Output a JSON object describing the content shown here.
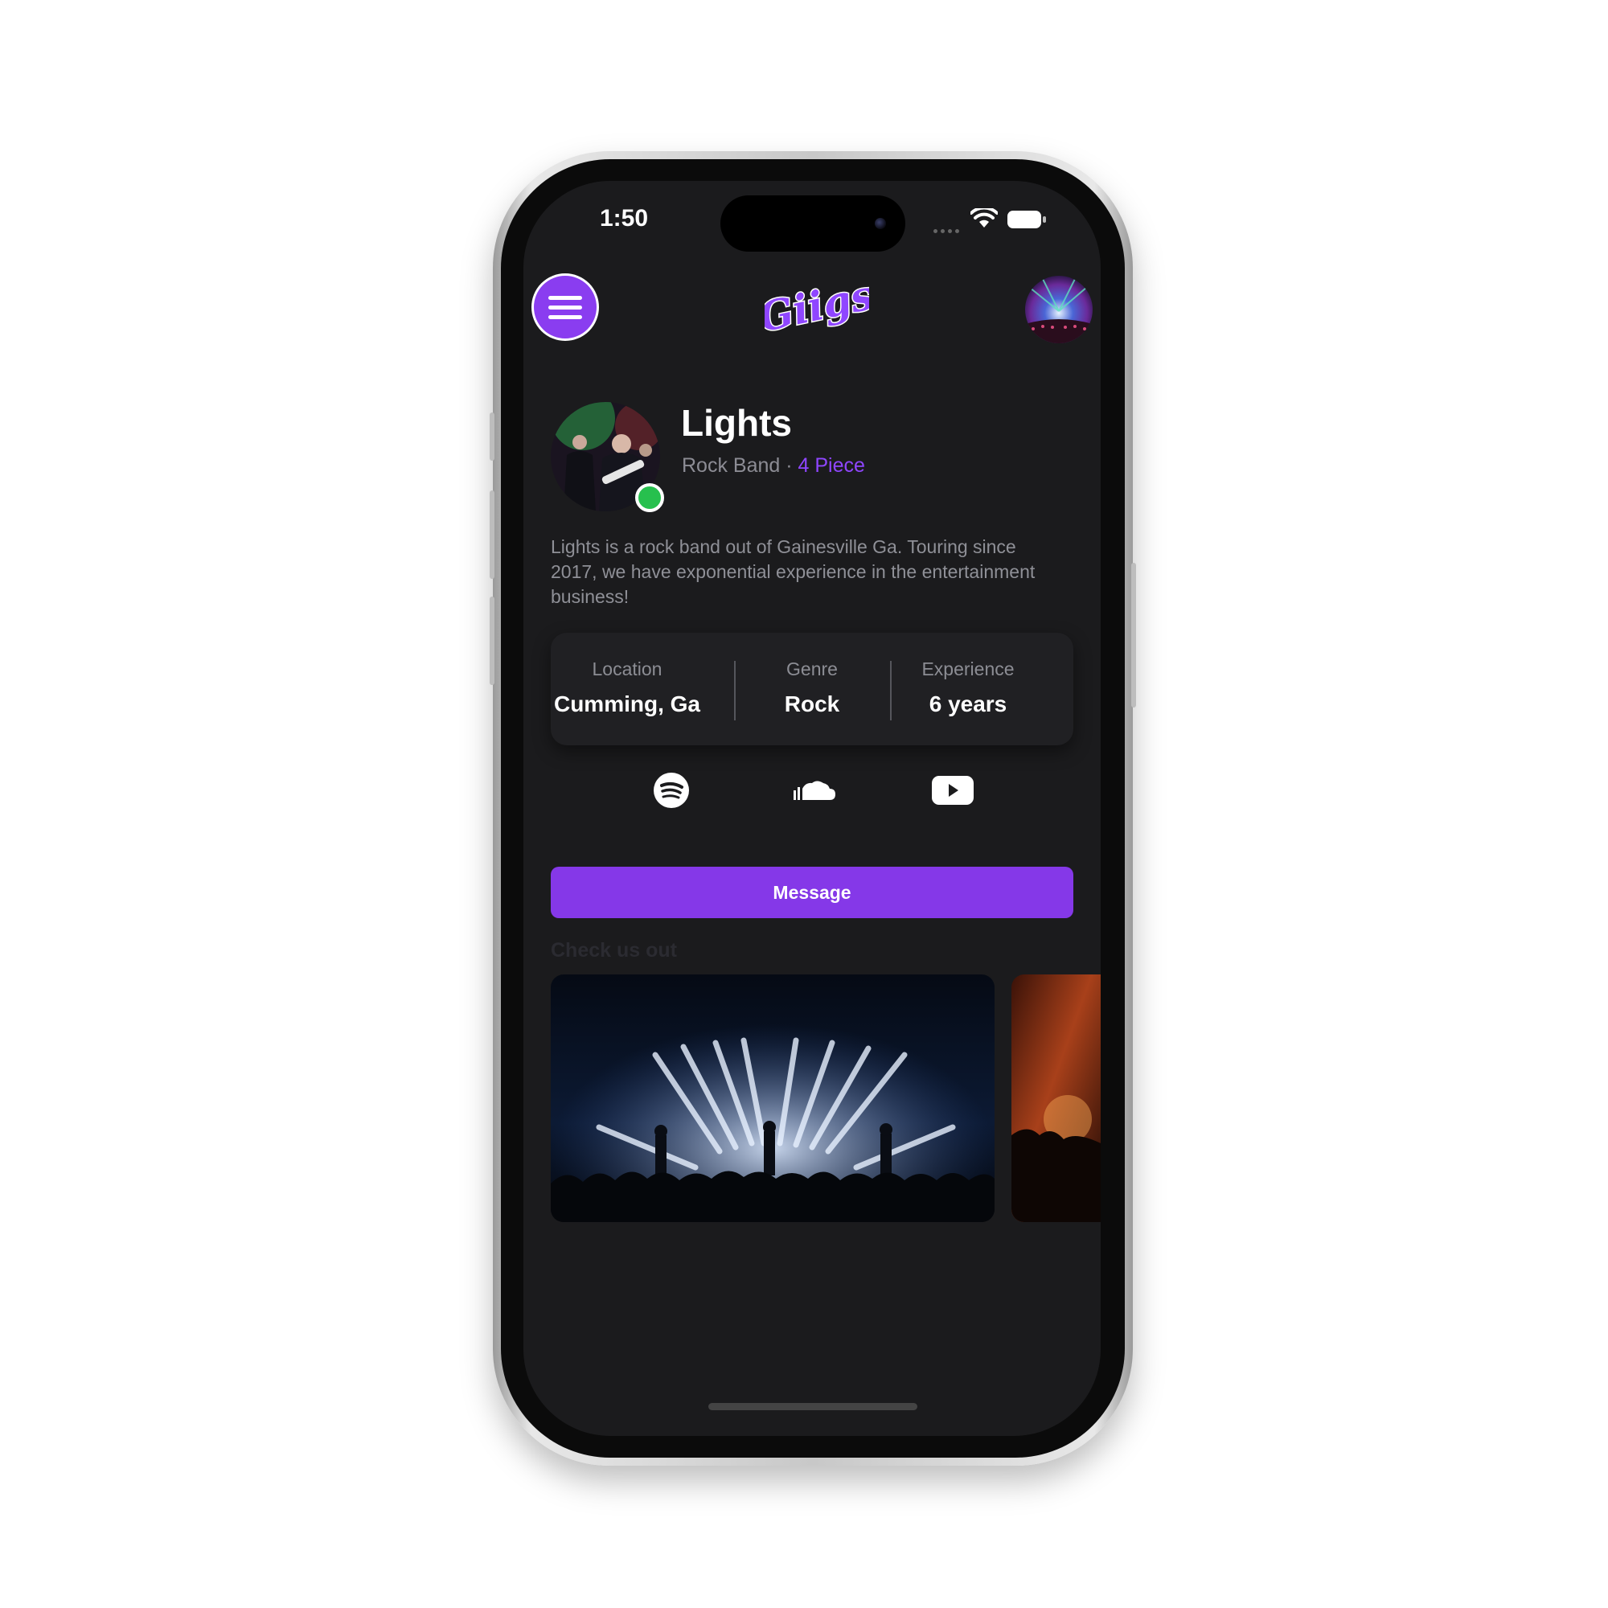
{
  "status_bar": {
    "time": "1:50"
  },
  "header": {
    "app_name": "Giigs"
  },
  "profile": {
    "name": "Lights",
    "category": "Rock Band",
    "separator": "·",
    "size": "4 Piece",
    "online": true,
    "bio": "Lights is a rock band out of Gainesville Ga. Touring since 2017, we have exponential experience in the entertainment business!"
  },
  "stats": [
    {
      "label": "Location",
      "value": "Cumming, Ga"
    },
    {
      "label": "Genre",
      "value": "Rock"
    },
    {
      "label": "Experience",
      "value": "6 years"
    }
  ],
  "social_links": [
    "spotify-icon",
    "soundcloud-icon",
    "youtube-icon"
  ],
  "actions": {
    "message_label": "Message"
  },
  "gallery": {
    "heading": "Check us out"
  },
  "colors": {
    "accent": "#8538e8",
    "background": "#1b1b1d",
    "card": "#202023",
    "online": "#27c04e"
  }
}
